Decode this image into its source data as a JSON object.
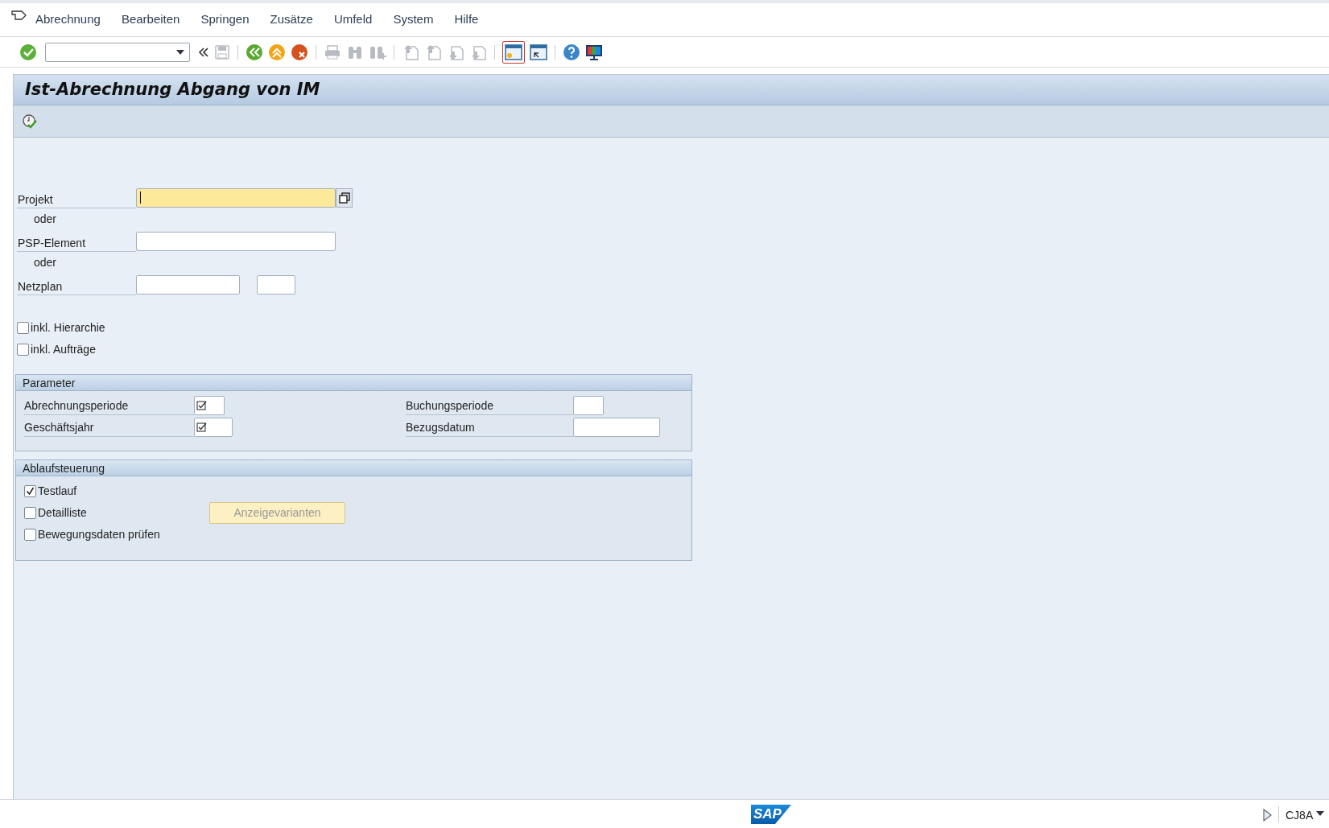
{
  "menu_bar": {
    "items": [
      "Abrechnung",
      "Bearbeiten",
      "Springen",
      "Zusätze",
      "Umfeld",
      "System",
      "Hilfe"
    ]
  },
  "title": "Ist-Abrechnung Abgang von IM",
  "selection": [
    {
      "kind": "field",
      "label": "Projekt",
      "fields": [
        {
          "focused": true,
          "value_help": true
        }
      ]
    },
    {
      "kind": "text",
      "label": "oder"
    },
    {
      "kind": "field",
      "label": "PSP-Element",
      "fields": [
        {
          "focused": false,
          "value_help": false
        }
      ]
    },
    {
      "kind": "text",
      "label": "oder"
    },
    {
      "kind": "field",
      "label": "Netzplan",
      "fields": [
        {
          "focused": false,
          "value_help": false
        },
        {
          "focused": false,
          "value_help": false
        }
      ]
    }
  ],
  "options": [
    {
      "label": "inkl. Hierarchie",
      "checked": false
    },
    {
      "label": "inkl. Aufträge",
      "checked": false
    }
  ],
  "parameter_group": {
    "title": "Parameter",
    "fields": [
      {
        "label": "Abrechnungsperiode",
        "required": true
      },
      {
        "label": "Buchungsperiode",
        "required": false
      },
      {
        "label": "Geschäftsjahr",
        "required": true
      },
      {
        "label": "Bezugsdatum",
        "required": false
      }
    ]
  },
  "control_group": {
    "title": "Ablaufsteuerung",
    "checkboxes": [
      {
        "label": "Testlauf",
        "checked": true
      },
      {
        "label": "Detailliste",
        "checked": false
      },
      {
        "label": "Bewegungsdaten prüfen",
        "checked": false
      }
    ],
    "button": {
      "label": "Anzeigevarianten",
      "disabled": true
    }
  },
  "status_bar": {
    "logo": "SAP",
    "transaction": "CJ8A"
  }
}
